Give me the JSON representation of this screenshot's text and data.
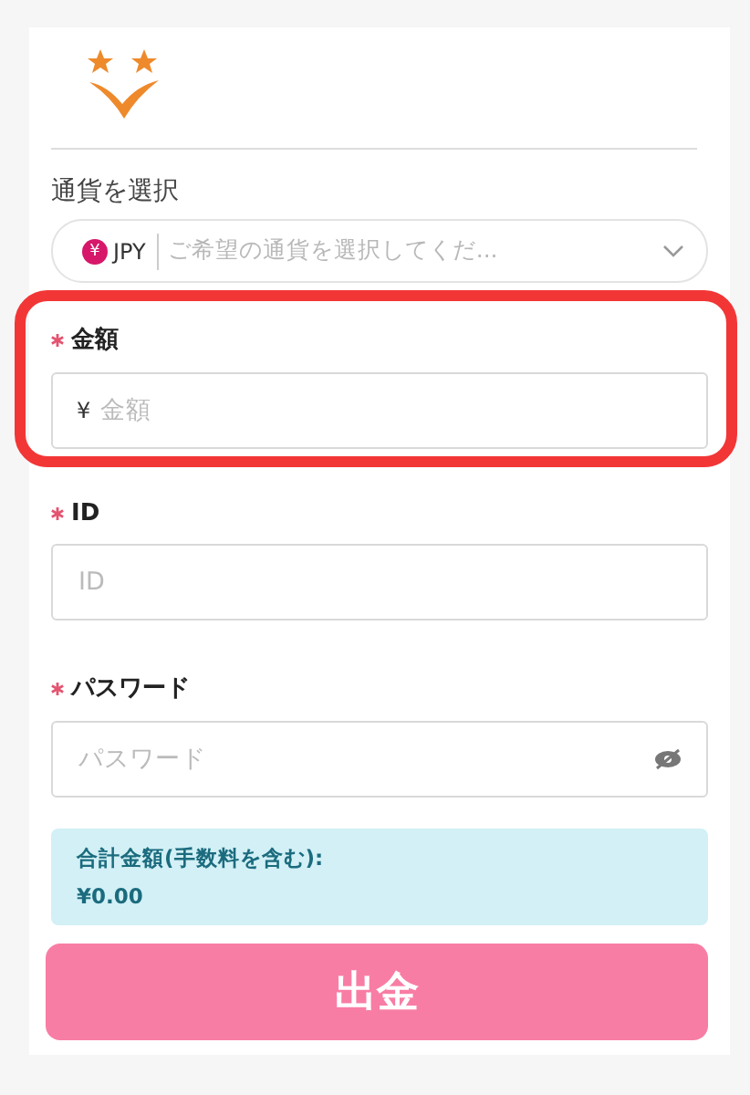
{
  "currency": {
    "label": "通貨を選択",
    "code": "JPY",
    "symbol": "¥",
    "placeholder": "ご希望の通貨を選択してくだ..."
  },
  "fields": [
    {
      "kind": "amount",
      "label": "金額",
      "required": true,
      "prefix": "¥",
      "placeholder": "金額",
      "highlighted": true
    },
    {
      "kind": "text",
      "label": "ID",
      "required": true,
      "placeholder": "ID",
      "highlighted": false
    },
    {
      "kind": "password",
      "label": "パスワード",
      "required": true,
      "placeholder": "パスワード",
      "highlighted": false
    }
  ],
  "total": {
    "label": "合計金額(手数料を含む):",
    "value": "¥0.00"
  },
  "submit": "出金"
}
